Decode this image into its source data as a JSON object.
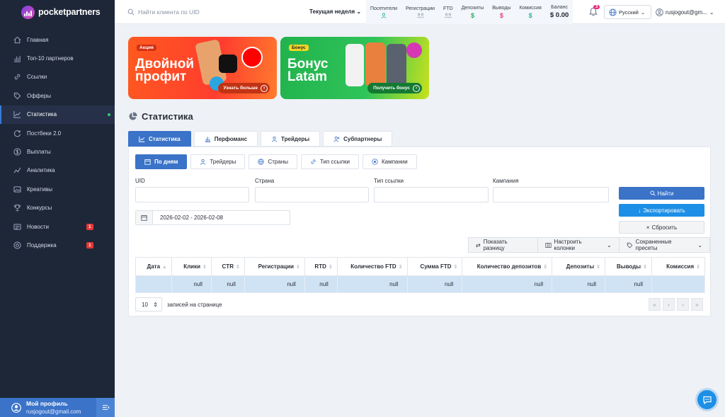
{
  "brand": {
    "name": "pocketpartners"
  },
  "sidebar": {
    "items": [
      {
        "label": "Главная",
        "icon": "home-icon"
      },
      {
        "label": "Топ-10 партнеров",
        "icon": "chart-bars-icon"
      },
      {
        "label": "Ссылки",
        "icon": "link-icon"
      },
      {
        "label": "Офферы",
        "icon": "tag-icon"
      },
      {
        "label": "Статистика",
        "icon": "line-chart-icon",
        "active": true
      },
      {
        "label": "Постбеки 2.0",
        "icon": "postback-icon"
      },
      {
        "label": "Выплаты",
        "icon": "dollar-icon"
      },
      {
        "label": "Аналитика",
        "icon": "analytics-icon"
      },
      {
        "label": "Креативы",
        "icon": "image-icon"
      },
      {
        "label": "Конкурсы",
        "icon": "trophy-icon"
      },
      {
        "label": "Новости",
        "icon": "news-icon",
        "badge": "1"
      },
      {
        "label": "Поддержка",
        "icon": "support-icon",
        "badge": "1"
      }
    ]
  },
  "profile": {
    "name": "Мой профиль",
    "email": "rusjogout@gmail.com"
  },
  "topbar": {
    "search_placeholder": "Найти клиента по UID",
    "period": "Текущая неделя",
    "stats": [
      {
        "label": "Посетители",
        "value": "",
        "icon": "visitors-icon"
      },
      {
        "label": "Регистрации",
        "value": "",
        "icon": "registrations-icon"
      },
      {
        "label": "FTD",
        "value": "",
        "icon": "ftd-icon"
      },
      {
        "label": "Депозиты",
        "value": "$"
      },
      {
        "label": "Выводы",
        "value": "$"
      },
      {
        "label": "Комиссия",
        "value": "$"
      },
      {
        "label": "Баланс",
        "value": "$ 0.00"
      }
    ],
    "notifications": "3",
    "language": "Русский",
    "user": "rusjogout@gm..."
  },
  "banners": [
    {
      "tag": "Акция",
      "title": "Двойной профит",
      "button": "Узнать больше"
    },
    {
      "tag": "Бонус",
      "title": "Бонус Latam",
      "button": "Получить бонус"
    }
  ],
  "page": {
    "title": "Статистика"
  },
  "outer_tabs": [
    "Статистика",
    "Перфоманс",
    "Трейдеры",
    "Субпартнеры"
  ],
  "inner_tabs": [
    "По дням",
    "Трейдеры",
    "Страны",
    "Тип ссылки",
    "Кампании"
  ],
  "filters": {
    "uid_label": "UID",
    "country_label": "Страна",
    "link_type_label": "Тип ссылки",
    "campaign_label": "Кампания",
    "date_range": "2026-02-02 - 2026-02-08"
  },
  "actions": {
    "find": "Найти",
    "export": "Экспортировать",
    "reset": "Сбросить"
  },
  "tools": {
    "show_diff": "Показать разницу",
    "columns": "Настроить колонки",
    "presets": "Сохраненные пресеты"
  },
  "table": {
    "columns": [
      "Дата",
      "Клики",
      "CTR",
      "Регистрации",
      "RTD",
      "Количество FTD",
      "Сумма FTD",
      "Количество депозитов",
      "Депозиты",
      "Выводы",
      "Комиссия"
    ],
    "row": [
      "",
      "null",
      "null",
      "null",
      "null",
      "null",
      "null",
      "null",
      "null",
      "null",
      ""
    ]
  },
  "pagination": {
    "per_page": "10",
    "label": "записей на странице"
  }
}
